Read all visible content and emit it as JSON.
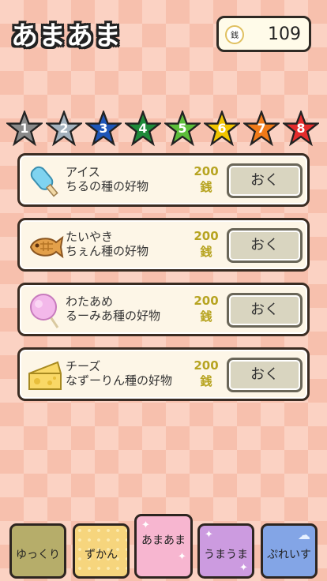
{
  "header": {
    "title": "あまあま",
    "currency_icon": "銭",
    "money": "109"
  },
  "stars": [
    {
      "label": "1",
      "color": "#8a8a8a"
    },
    {
      "label": "2",
      "color": "#a3b1bd"
    },
    {
      "label": "3",
      "color": "#1e56b8"
    },
    {
      "label": "4",
      "color": "#1f8a3a"
    },
    {
      "label": "5",
      "color": "#5cbd3a"
    },
    {
      "label": "6",
      "color": "#f0c400"
    },
    {
      "label": "7",
      "color": "#f07a18"
    },
    {
      "label": "8",
      "color": "#e42c2c"
    }
  ],
  "items": [
    {
      "name": "アイス",
      "desc": "ちるの種の好物",
      "price": "200",
      "currency": "銭",
      "button": "おく",
      "icon": "ice-pop-icon"
    },
    {
      "name": "たいやき",
      "desc": "ちぇん種の好物",
      "price": "200",
      "currency": "銭",
      "button": "おく",
      "icon": "taiyaki-icon"
    },
    {
      "name": "わたあめ",
      "desc": "るーみあ種の好物",
      "price": "200",
      "currency": "銭",
      "button": "おく",
      "icon": "cotton-candy-icon"
    },
    {
      "name": "チーズ",
      "desc": "なずーりん種の好物",
      "price": "200",
      "currency": "銭",
      "button": "おく",
      "icon": "cheese-icon"
    }
  ],
  "tabs": [
    {
      "label": "ゆっくり"
    },
    {
      "label": "ずかん"
    },
    {
      "label": "あまあま"
    },
    {
      "label": "うまうま"
    },
    {
      "label": "ぷれいす"
    }
  ]
}
